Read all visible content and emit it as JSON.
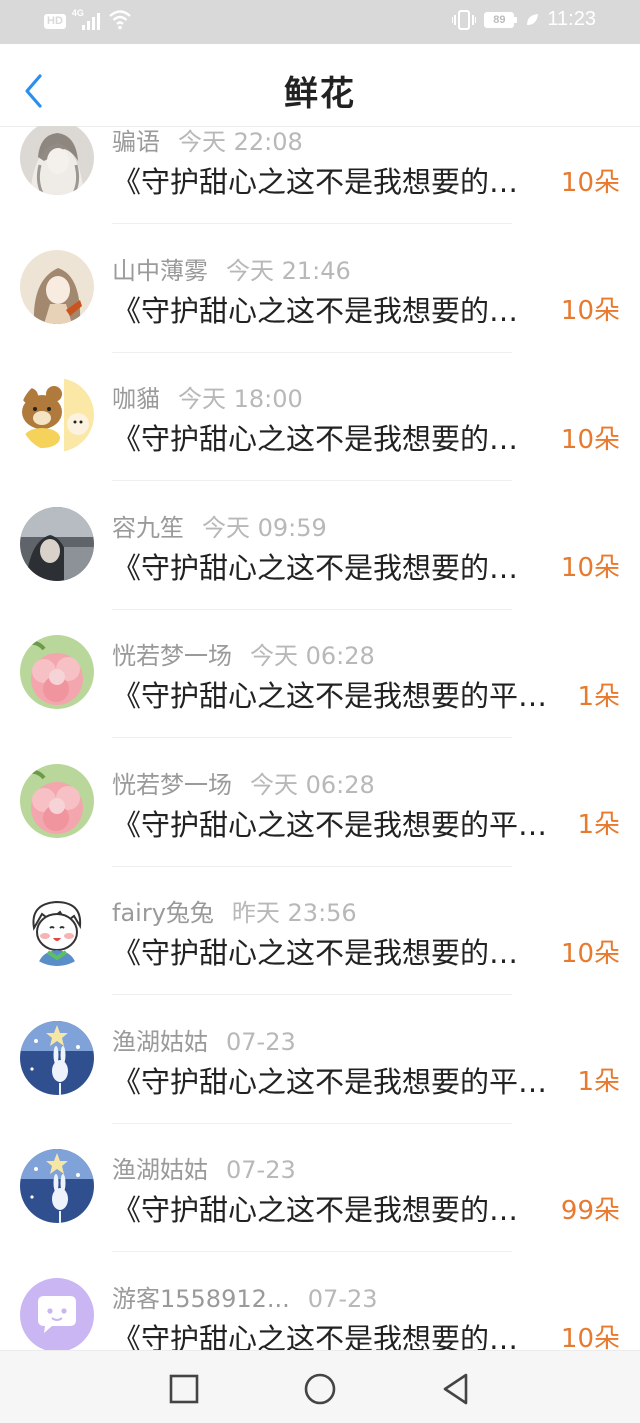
{
  "status_bar": {
    "hd": "HD",
    "network": "4G",
    "battery": "89",
    "time": "11:23"
  },
  "header": {
    "title": "鲜花"
  },
  "records": [
    {
      "name": "骗语",
      "time": "今天 22:08",
      "book": "《守护甜心之这不是我想要的平凡生活》",
      "count": "10朵",
      "avatar": {
        "bg": "#dcd8d3",
        "fg": "#7a736c",
        "icon": "sketch-girl"
      }
    },
    {
      "name": "山中薄雾",
      "time": "今天 21:46",
      "book": "《守护甜心之这不是我想要的平凡生活》",
      "count": "10朵",
      "avatar": {
        "bg": "#eee4d6",
        "fg": "#8a6a4e",
        "icon": "anime-girl"
      }
    },
    {
      "name": "咖貓",
      "time": "今天 18:00",
      "book": "《守护甜心之这不是我想要的平凡生活》",
      "count": "10朵",
      "avatar": {
        "bg": "#f5d35a",
        "fg": "#b07a3c",
        "icon": "rilakkuma"
      }
    },
    {
      "name": "容九笙",
      "time": "今天 09:59",
      "book": "《守护甜心之这不是我想要的平凡生活》",
      "count": "10朵",
      "avatar": {
        "bg": "#7c8088",
        "fg": "#cfd2d6",
        "icon": "photo-girl"
      }
    },
    {
      "name": "恍若梦一场",
      "time": "今天 06:28",
      "book": "《守护甜心之这不是我想要的平凡生活》",
      "count": "1朵",
      "avatar": {
        "bg": "#b9d79a",
        "fg": "#f3a6ae",
        "icon": "pink-flower"
      }
    },
    {
      "name": "恍若梦一场",
      "time": "今天 06:28",
      "book": "《守护甜心之这不是我想要的平凡生活》",
      "count": "1朵",
      "avatar": {
        "bg": "#b9d79a",
        "fg": "#f3a6ae",
        "icon": "pink-flower"
      }
    },
    {
      "name": "fairy兔兔",
      "time": "昨天 23:56",
      "book": "《守护甜心之这不是我想要的平凡生活》",
      "count": "10朵",
      "avatar": {
        "bg": "#ffffff",
        "fg": "#4a5c7a",
        "icon": "cartoon-boy"
      }
    },
    {
      "name": "渔湖姑姑",
      "time": "07-23",
      "book": "《守护甜心之这不是我想要的平凡生活》",
      "count": "1朵",
      "avatar": {
        "bg": "#2f4f8f",
        "fg": "#f6e6a6",
        "icon": "star-rabbit"
      }
    },
    {
      "name": "渔湖姑姑",
      "time": "07-23",
      "book": "《守护甜心之这不是我想要的平凡生活》",
      "count": "99朵",
      "avatar": {
        "bg": "#2f4f8f",
        "fg": "#f6e6a6",
        "icon": "star-rabbit"
      }
    },
    {
      "name": "游客1558912...",
      "time": "07-23",
      "book": "《守护甜心之这不是我想要的平凡生活》",
      "count": "10朵",
      "avatar": {
        "bg": "#c9b6f2",
        "fg": "#ffffff",
        "icon": "chat-bubble"
      }
    }
  ],
  "nav": {
    "buttons": [
      "recents-button",
      "home-button",
      "back-button"
    ]
  },
  "colors": {
    "accent": "#e77a2f",
    "back_arrow": "#2b8ef0",
    "status_bar": "#d9d9d9"
  }
}
